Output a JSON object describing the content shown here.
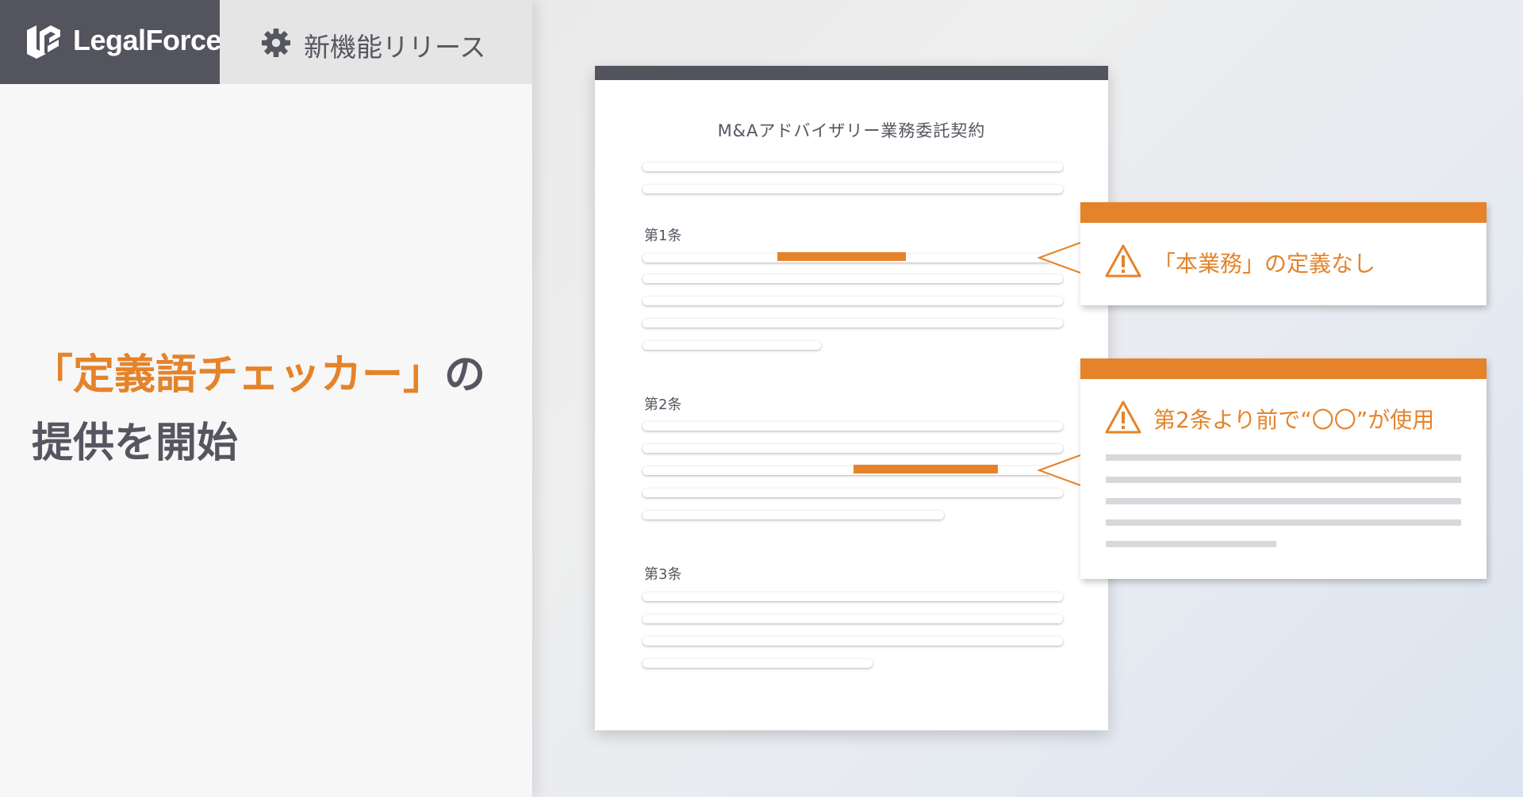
{
  "brand": {
    "name": "LegalForce"
  },
  "header": {
    "release_label": "新機能リリース"
  },
  "headline": {
    "accent": "「定義語チェッカー」",
    "suffix": "の",
    "line2": "提供を開始"
  },
  "document": {
    "title": "M&Aアドバイザリー業務委託契約",
    "articles": [
      "第1条",
      "第2条",
      "第3条"
    ]
  },
  "callouts": [
    {
      "icon": "warning-icon",
      "text": "「本業務」の定義なし"
    },
    {
      "icon": "warning-icon",
      "text": "第2条より前で“〇〇”が使用"
    }
  ],
  "colors": {
    "accent": "#e5832a",
    "dark": "#53545e",
    "text": "#555660"
  }
}
